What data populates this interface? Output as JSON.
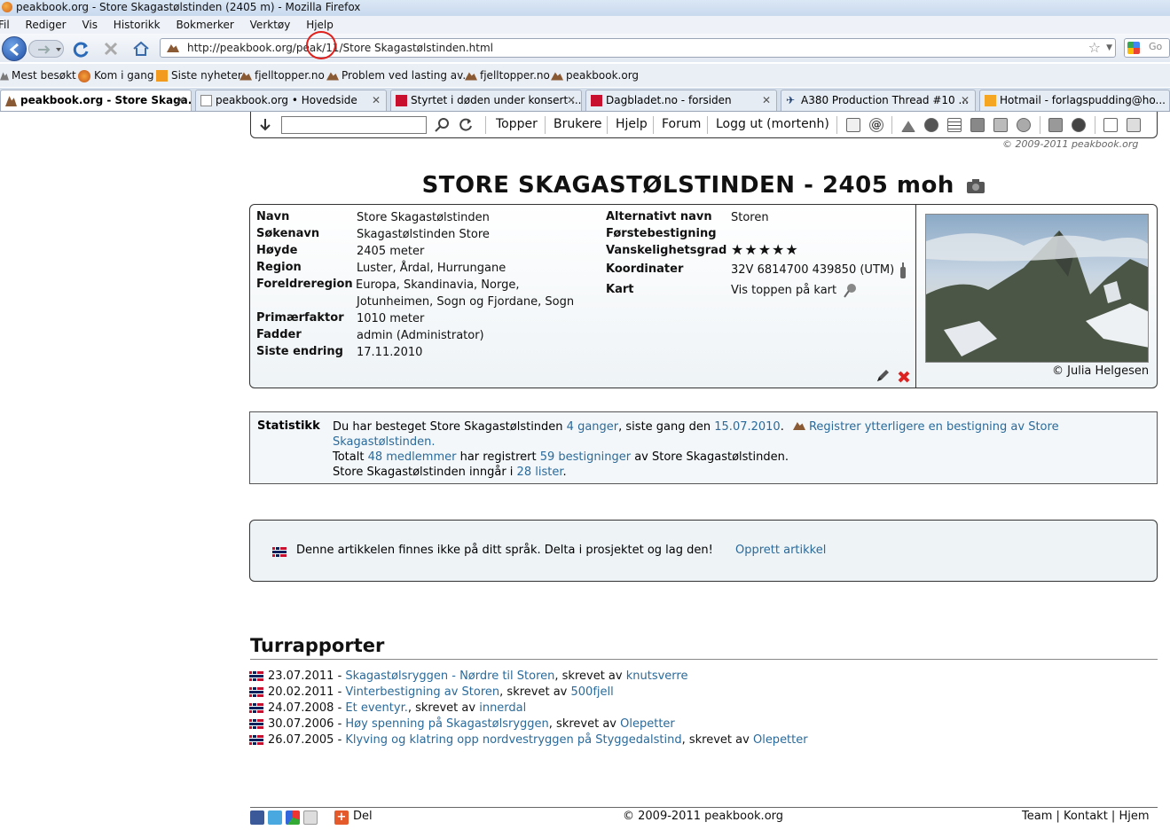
{
  "browser": {
    "window_title": "peakbook.org - Store Skagastølstinden (2405 m) - Mozilla Firefox",
    "menu": [
      "Fil",
      "Rediger",
      "Vis",
      "Historikk",
      "Bokmerker",
      "Verktøy",
      "Hjelp"
    ],
    "url": "http://peakbook.org/peak/11/Store Skagastølstinden.html",
    "bookmarks": [
      "Mest besøkt",
      "Kom i gang",
      "Siste nyheter",
      "fjelltopper.no",
      "Problem ved lasting av...",
      "fjelltopper.no",
      "peakbook.org"
    ],
    "tabs": [
      {
        "label": "peakbook.org - Store Skaga...",
        "active": true
      },
      {
        "label": "peakbook.org • Hovedside"
      },
      {
        "label": "Styrtet i døden under konsert ..."
      },
      {
        "label": "Dagbladet.no - forsiden"
      },
      {
        "label": "A380 Production Thread #10 ..."
      },
      {
        "label": "Hotmail - forlagspudding@ho..."
      }
    ]
  },
  "site_nav": {
    "links": [
      "Topper",
      "Brukere",
      "Hjelp",
      "Forum",
      "Logg ut (mortenh)"
    ],
    "search_placeholder": "",
    "copyright": "© 2009-2011 peakbook.org"
  },
  "peak": {
    "title": "STORE SKAGASTØLSTINDEN - 2405 moh",
    "fields": {
      "navn_label": "Navn",
      "navn": "Store Skagastølstinden",
      "sokenavn_label": "Søkenavn",
      "sokenavn": "Skagastølstinden Store",
      "hoyde_label": "Høyde",
      "hoyde": "2405 meter",
      "region_label": "Region",
      "region": "Luster, Årdal, Hurrungane",
      "foreldre_label": "Foreldreregion",
      "foreldre_line1": "Europa, Skandinavia, Norge,",
      "foreldre_line2": "Jotunheimen, Sogn og Fjordane, Sogn",
      "primaer_label": "Primærfaktor",
      "primaer": "1010 meter",
      "fadder_label": "Fadder",
      "fadder": "admin (Administrator)",
      "endring_label": "Siste endring",
      "endring": "17.11.2010",
      "alt_label": "Alternativt navn",
      "alt": "Storen",
      "forste_label": "Førstebestigning",
      "forste": "",
      "vansk_label": "Vanskelighetsgrad",
      "vansk_stars": "★★★★★",
      "koord_label": "Koordinater",
      "koord": "32V 6814700 439850 (UTM)",
      "kart_label": "Kart",
      "kart": "Vis toppen på kart"
    },
    "photo_credit": "© Julia Helgesen"
  },
  "stats": {
    "label": "Statistikk",
    "l1a": "Du har besteget Store Skagastølstinden ",
    "l1_count": "4 ganger",
    "l1b": ", siste gang den ",
    "l1_date": "15.07.2010",
    "l1c": ".",
    "register": "Registrer ytterligere en bestigning av Store",
    "register2": "Skagastølstinden.",
    "l2a": "Totalt ",
    "l2_members": "48 medlemmer",
    "l2b": " har registrert ",
    "l2_ascents": "59 bestigninger",
    "l2c": " av Store Skagastølstinden.",
    "l3a": "Store Skagastølstinden inngår i ",
    "l3_lists": "28 lister",
    "l3b": "."
  },
  "lang_notice": {
    "text": "Denne artikkelen finnes ikke på ditt språk. Delta i prosjektet og lag den!",
    "link": "Opprett artikkel"
  },
  "trip_reports": {
    "heading": "Turrapporter",
    "written_by": "skrevet av",
    "items": [
      {
        "date": "23.07.2011",
        "title": "Skagastølsryggen - Nørdre til Storen",
        "author": "knutsverre"
      },
      {
        "date": "20.02.2011",
        "title": "Vinterbestigning av Storen",
        "author": "500fjell"
      },
      {
        "date": "24.07.2008",
        "title": "Et eventyr.",
        "author": "innerdal"
      },
      {
        "date": "30.07.2006",
        "title": "Høy spenning på Skagastølsryggen",
        "author": "Olepetter"
      },
      {
        "date": "26.07.2005",
        "title": "Klyving og klatring opp nordvestryggen på Styggedalstind",
        "author": "Olepetter"
      }
    ]
  },
  "footer": {
    "share": "Del",
    "copyright": "© 2009-2011 peakbook.org",
    "links": [
      "Team",
      "Kontakt",
      "Hjem"
    ]
  },
  "colors": {
    "link": "#2a6a9a",
    "annotation_circle": "#e0201c"
  }
}
